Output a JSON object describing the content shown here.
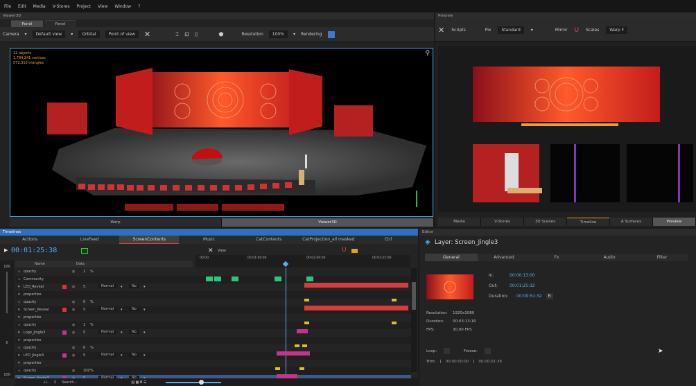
{
  "menu": [
    "File",
    "Edit",
    "Media",
    "V-Stores",
    "Project",
    "View",
    "Window",
    "?"
  ],
  "viewer": {
    "title": "Viewer3D",
    "tabs": [
      "Panel",
      "Panel"
    ],
    "toolbar": {
      "camera": "Camera",
      "view": "Default view",
      "orbital": "Orbital",
      "pov": "Point of view",
      "resolution_label": "Resolution",
      "resolution_value": "100%",
      "rendering": "Rendering"
    },
    "stats": [
      "12 objects",
      "1,784,241 vertices",
      "572,310 triangles"
    ],
    "bottom_tabs": [
      "Warp",
      "Viewer3D"
    ]
  },
  "preview": {
    "title": "Preview",
    "toolbar": {
      "scripts": "Scripts",
      "pix_label": "Pix",
      "pix_value": "Standard",
      "mirror": "Mirror",
      "scales": "Scales",
      "warp": "Warp F"
    },
    "bottom_tabs": [
      "Media",
      "V-Stores",
      "3D Scenes",
      "Timeline",
      "A Surfaces",
      "Preview"
    ]
  },
  "timeline": {
    "title": "Timelines",
    "tabs": [
      "Actions",
      "LiveFeed",
      "ScreenContents",
      "Music",
      "CatContents",
      "CatProjection_all masked",
      "Ctrl"
    ],
    "timecode": "00:01:25:38",
    "ruler": [
      "00:00",
      "00:01:00:00",
      "00:02:00:00",
      "00:03:25:00"
    ],
    "view_label": "View",
    "col_name": "Name",
    "col_data": "Data",
    "rows": [
      {
        "name": "opacity",
        "val": "1",
        "pct": "%",
        "sel": false
      },
      {
        "name": "Community",
        "val": "",
        "pct": "",
        "sel": false
      },
      {
        "name": "LED_Reveal",
        "val": "5",
        "pct": "",
        "blend": "Normal",
        "mode": "No",
        "sel": false
      },
      {
        "name": "properties",
        "val": "",
        "pct": "",
        "sel": false
      },
      {
        "name": "opacity",
        "val": "0",
        "pct": "%",
        "sel": false
      },
      {
        "name": "Screen_Reveal",
        "val": "5",
        "pct": "",
        "blend": "Normal",
        "mode": "No",
        "sel": false
      },
      {
        "name": "properties",
        "val": "",
        "pct": "",
        "sel": false
      },
      {
        "name": "opacity",
        "val": "1",
        "pct": "%",
        "sel": false
      },
      {
        "name": "Logo_Jingle3",
        "val": "5",
        "pct": "",
        "blend": "Normal",
        "mode": "No",
        "sel": false
      },
      {
        "name": "properties",
        "val": "",
        "pct": "",
        "sel": false
      },
      {
        "name": "opacity",
        "val": "0",
        "pct": "%",
        "sel": false
      },
      {
        "name": "LED_Jingle3",
        "val": "5",
        "pct": "",
        "blend": "Normal",
        "mode": "No",
        "sel": false
      },
      {
        "name": "properties",
        "val": "",
        "pct": "",
        "sel": false
      },
      {
        "name": "opacity",
        "val": "100",
        "pct": "%",
        "sel": false
      },
      {
        "name": "Screen_Jingle3",
        "val": "5",
        "pct": "",
        "blend": "Normal",
        "mode": "No",
        "sel": true
      }
    ],
    "left_nums": [
      "100",
      "0",
      "100"
    ],
    "search": "Search..."
  },
  "editor": {
    "title": "Editor",
    "layer": "Layer: Screen_Jingle3",
    "tabs": [
      "General",
      "Advanced",
      "Fx",
      "Audio",
      "Filter"
    ],
    "in_label": "In:",
    "in_value": "00:00:13:00",
    "out_label": "Out:",
    "out_value": "00:01:25:32",
    "dur_label": "Duration:",
    "dur_value": "00:00:51:32",
    "r_btn": "R",
    "res_label": "Resolution:",
    "res_value": "1920x1080",
    "duration_label": "Duration:",
    "duration_value": "00:03:13:16",
    "fps_label": "FPS:",
    "fps_value": "30.00 FPS",
    "loop_label": "Loop:",
    "freeze_label": "Freeze:",
    "trim_label": "Trim:",
    "trim_start": "00:00:00:00",
    "trim_end": "00:00:01:36"
  }
}
